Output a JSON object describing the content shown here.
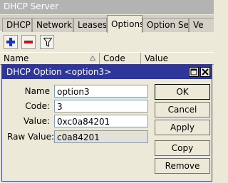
{
  "window": {
    "title": "DHCP Server"
  },
  "tabs": [
    {
      "label": "DHCP",
      "active": false
    },
    {
      "label": "Networks",
      "active": false
    },
    {
      "label": "Leases",
      "active": false
    },
    {
      "label": "Options",
      "active": true
    },
    {
      "label": "Option Sets",
      "active": false
    },
    {
      "label": "Ve",
      "active": false
    }
  ],
  "toolbar": {
    "add_icon": "plus-icon",
    "remove_icon": "minus-icon",
    "filter_icon": "filter-icon"
  },
  "columns": [
    {
      "label": "Name"
    },
    {
      "label": "Code"
    },
    {
      "label": "Value"
    }
  ],
  "dialog": {
    "title": "DHCP Option <option3>",
    "fields": {
      "name": {
        "label": "Name",
        "value": "option3"
      },
      "code": {
        "label": "Code:",
        "value": "3"
      },
      "value": {
        "label": "Value:",
        "value": "0xc0a84201"
      },
      "raw_value": {
        "label": "Raw Value:",
        "value": "c0a84201"
      }
    },
    "buttons": {
      "ok": "OK",
      "cancel": "Cancel",
      "apply": "Apply",
      "copy": "Copy",
      "remove": "Remove"
    }
  },
  "colors": {
    "dialog_titlebar": "#2f3699",
    "window_titlebar": "#b3b3b3",
    "add": "#1a32c2",
    "remove": "#c8101c"
  }
}
